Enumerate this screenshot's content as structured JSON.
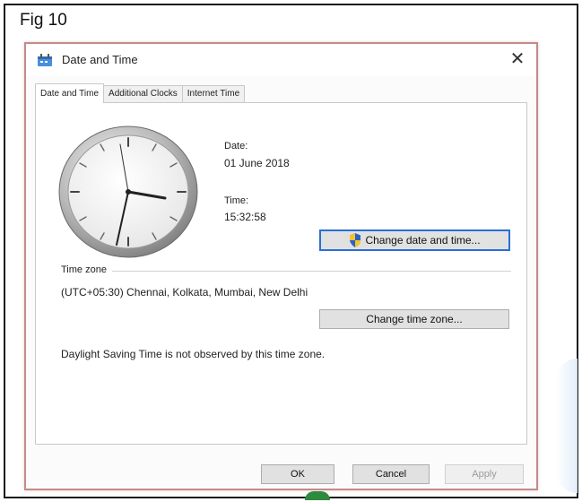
{
  "figure": {
    "label": "Fig 10"
  },
  "window": {
    "title": "Date and Time",
    "close_glyph": "✕",
    "icon": "date-time-icon"
  },
  "tabs": [
    {
      "label": "Date and Time",
      "active": true
    },
    {
      "label": "Additional Clocks",
      "active": false
    },
    {
      "label": "Internet Time",
      "active": false
    }
  ],
  "panel": {
    "date_label": "Date:",
    "date_value": "01 June 2018",
    "time_label": "Time:",
    "time_value": "15:32:58",
    "change_date_button": "Change date and time...",
    "time_zone_heading": "Time zone",
    "time_zone_value": "(UTC+05:30) Chennai, Kolkata, Mumbai, New Delhi",
    "change_time_zone_button": "Change time zone...",
    "dst_text": "Daylight Saving Time is not observed by this time zone."
  },
  "footer": {
    "ok": "OK",
    "cancel": "Cancel",
    "apply": "Apply"
  },
  "colors": {
    "dialog_border": "#c58a8a",
    "focus_blue": "#2a6fd6",
    "shield_blue": "#2b62c8",
    "shield_yellow": "#f2c230"
  }
}
